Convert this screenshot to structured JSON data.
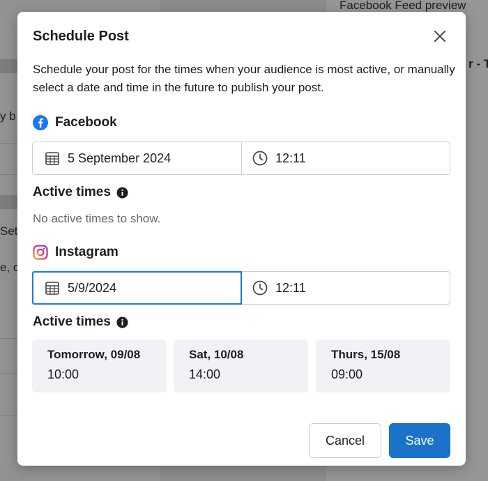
{
  "background": {
    "preview_title": "Facebook Feed preview",
    "fragment_right": "r - T",
    "fragment_left_1": "y b",
    "fragment_left_2": "Set",
    "fragment_left_3": "e, o"
  },
  "modal": {
    "title": "Schedule Post",
    "close_icon": "close-icon",
    "description": "Schedule your post for the times when your audience is most active, or manually select a date and time in the future to publish your post.",
    "facebook": {
      "label": "Facebook",
      "icon": "facebook-icon",
      "date": "5 September 2024",
      "time": "12:11",
      "active_times_label": "Active times",
      "no_active_text": "No active times to show."
    },
    "instagram": {
      "label": "Instagram",
      "icon": "instagram-icon",
      "date": "5/9/2024",
      "time": "12:11",
      "active_times_label": "Active times",
      "active_times": [
        {
          "day": "Tomorrow, 09/08",
          "time": "10:00"
        },
        {
          "day": "Sat, 10/08",
          "time": "14:00"
        },
        {
          "day": "Thurs, 15/08",
          "time": "09:00"
        }
      ]
    },
    "cancel_label": "Cancel",
    "save_label": "Save"
  },
  "colors": {
    "accent": "#1877f2",
    "save_button": "#1a73c9",
    "card_bg": "#f0f2f5",
    "muted_text": "#65676b"
  }
}
